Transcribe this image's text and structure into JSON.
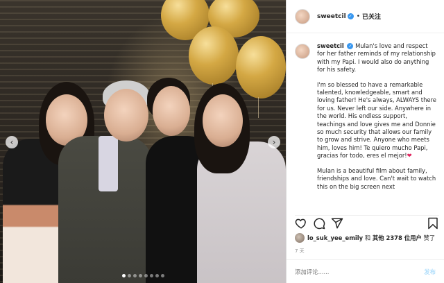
{
  "post": {
    "username": "sweetcil",
    "follow_separator": "•",
    "follow_label": "已关注",
    "caption_paragraphs": [
      "Mulan's love and respect for her father reminds of my relationship with my Papi. I would also do anything for his safety.",
      "I'm so blessed to have a remarkable talented, knowledgeable, smart and loving father! He's always, ALWAYS there for us. Never left our side. Anywhere in the world. His endless support, teachings and love gives me and Donnie so much security that allows our family to grow and strive. Anyone who meets him, loves him! Te quiero mucho Papi, gracias for todo, eres el mejor!",
      "Mulan is a beautiful film about family, friendships and love. Can't wait to watch this on the big screen next"
    ],
    "heart_emoji": "❤",
    "likes": {
      "liker": "lo_suk_yee_emily",
      "middle": " 和 ",
      "others": "其他 2378 位用户",
      "suffix": " 赞了"
    },
    "time_ago": "7 天",
    "comment_placeholder": "添加评论......",
    "post_button": "发布"
  },
  "icons": {
    "like": "heart-outline-icon",
    "comment": "comment-bubble-icon",
    "share": "paper-plane-icon",
    "save": "bookmark-icon",
    "prev": "chevron-left-icon",
    "next": "chevron-right-icon"
  },
  "carousel": {
    "dot_count": 8,
    "active_index": 0
  },
  "colors": {
    "verified": "#3897f0",
    "post_button_disabled": "#b2dffc",
    "heart": "#e0245e"
  }
}
